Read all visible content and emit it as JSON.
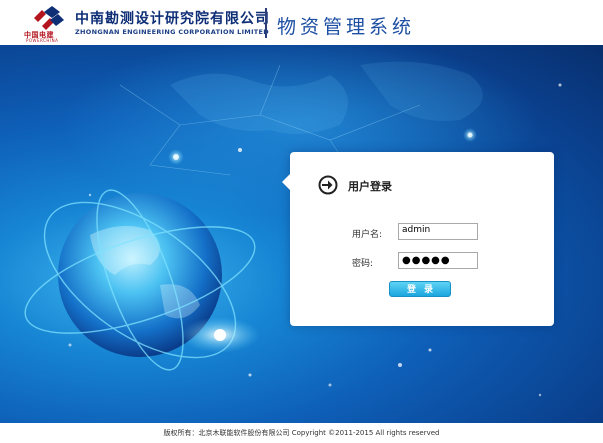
{
  "header": {
    "logo_cn": "中国电建",
    "logo_en": "POWERCHINA",
    "company_cn": "中南勘测设计研究院有限公司",
    "company_en": "ZHONGNAN ENGINEERING CORPORATION LIMITED",
    "system_title": "物资管理系统"
  },
  "login": {
    "title": "用户登录",
    "username_label": "用户名:",
    "username_value": "admin",
    "password_label": "密码:",
    "password_value": "●●●●●",
    "submit_label": "登录"
  },
  "footer": {
    "copyright": "版权所有：北京木联能软件股份有限公司 Copyright ©2011-2015 All rights reserved"
  },
  "colors": {
    "brand_navy": "#0e2e76",
    "brand_red": "#b4151f",
    "banner_blue": "#0e5fb8",
    "button_cyan": "#1aa6de"
  }
}
